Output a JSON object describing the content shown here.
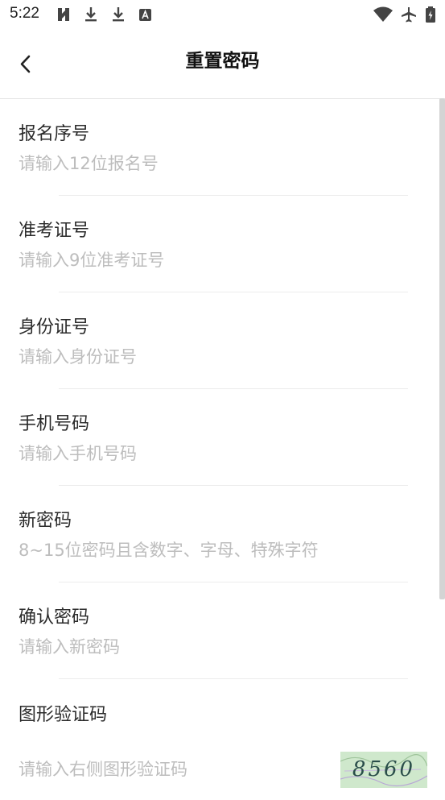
{
  "status": {
    "time": "5:22",
    "icons": [
      "app-icon",
      "download-icon",
      "download-icon",
      "text-icon",
      "wifi-icon",
      "airplane-icon",
      "battery-icon"
    ]
  },
  "header": {
    "title": "重置密码",
    "back_icon": "chevron-left-icon"
  },
  "form": {
    "fields": [
      {
        "label": "报名序号",
        "placeholder": "请输入12位报名号"
      },
      {
        "label": "准考证号",
        "placeholder": "请输入9位准考证号"
      },
      {
        "label": "身份证号",
        "placeholder": "请输入身份证号"
      },
      {
        "label": "手机号码",
        "placeholder": "请输入手机号码"
      },
      {
        "label": "新密码",
        "placeholder": "8~15位密码且含数字、字母、特殊字符"
      },
      {
        "label": "确认密码",
        "placeholder": "请输入新密码"
      },
      {
        "label": "图形验证码",
        "placeholder": "请输入右侧图形验证码"
      }
    ],
    "captcha_text": "8560"
  },
  "colors": {
    "placeholder": "#bdbdbd",
    "divider": "#ececec",
    "captcha_bg": "#cfe8cc",
    "captcha_text": "#2a4e4a"
  }
}
